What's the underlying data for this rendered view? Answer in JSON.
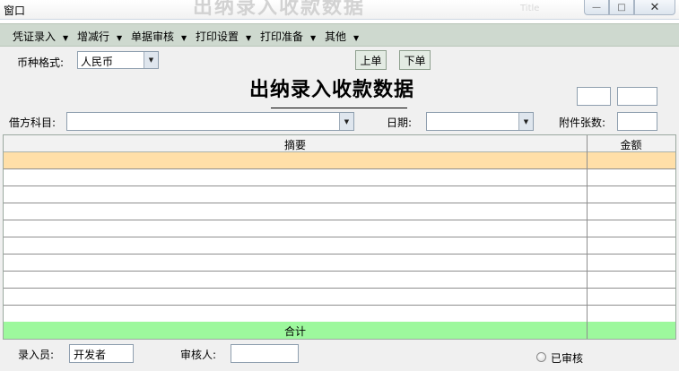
{
  "window": {
    "title": "窗口",
    "background_caption": "出纳录入收款数据",
    "background_small_caption": "Title"
  },
  "menu": [
    {
      "label": "凭证录入"
    },
    {
      "label": "增减行"
    },
    {
      "label": "单据审核"
    },
    {
      "label": "打印设置"
    },
    {
      "label": "打印准备"
    },
    {
      "label": "其他"
    }
  ],
  "currency": {
    "label": "币种格式:",
    "value": "人民币"
  },
  "nav": {
    "prev_label": "上单",
    "next_label": "下单"
  },
  "form_title": "出纳录入收款数据",
  "debit_account": {
    "label": "借方科目:",
    "value": ""
  },
  "date": {
    "label": "日期:",
    "value": ""
  },
  "attachments": {
    "label": "附件张数:",
    "value": ""
  },
  "grid": {
    "columns": [
      "摘要",
      "金额"
    ],
    "rows": [
      [
        "",
        ""
      ],
      [
        "",
        ""
      ],
      [
        "",
        ""
      ],
      [
        "",
        ""
      ],
      [
        "",
        ""
      ],
      [
        "",
        ""
      ],
      [
        "",
        ""
      ],
      [
        "",
        ""
      ],
      [
        "",
        ""
      ],
      [
        "",
        ""
      ]
    ],
    "total_label": "合计",
    "total_amount": ""
  },
  "footer": {
    "entry_label": "录入员:",
    "entry_value": "开发者",
    "reviewer_label": "审核人:",
    "reviewer_value": "",
    "reviewed_label": "已审核"
  },
  "colors": {
    "menubar": "#ced9cf",
    "selected_row": "#ffdfa8",
    "total_row": "#9df89d"
  }
}
